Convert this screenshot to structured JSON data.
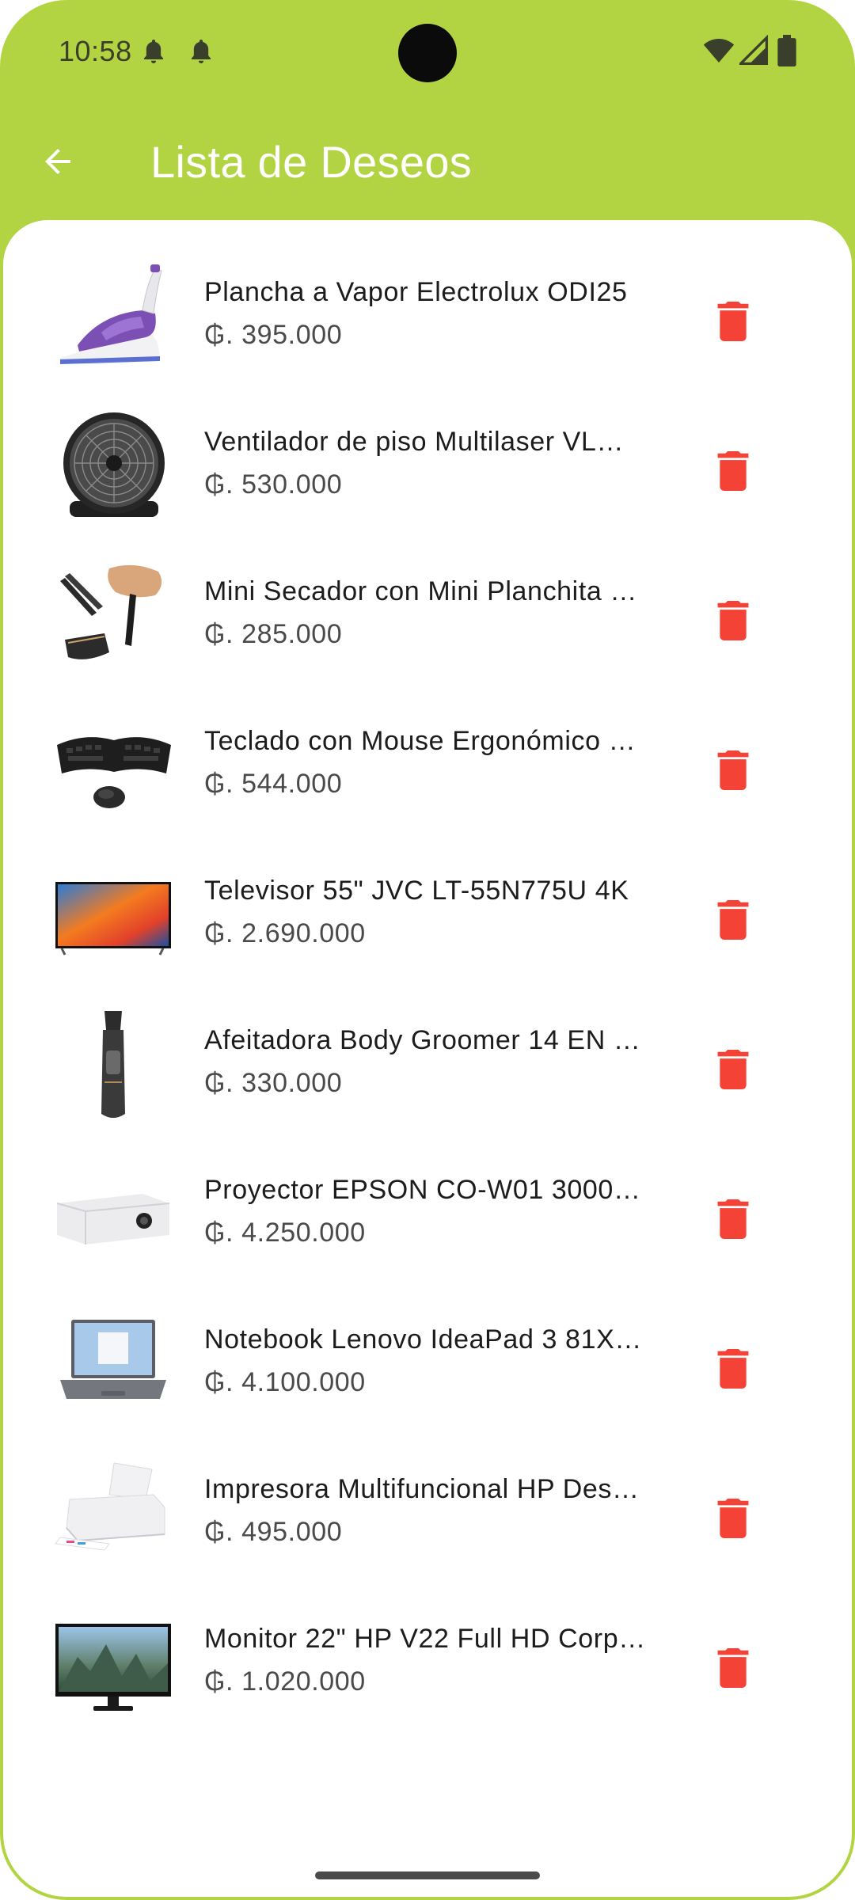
{
  "status_bar": {
    "time": "10:58",
    "icons": [
      "notification-bell-icon",
      "notification-bell-icon",
      "wifi-icon",
      "cell-signal-icon",
      "battery-icon"
    ]
  },
  "app_bar": {
    "title": "Lista de Deseos",
    "back_icon": "arrow-left-icon"
  },
  "colors": {
    "accent": "#b3d442",
    "delete": "#f44336",
    "title_text": "#ffffff"
  },
  "wishlist": {
    "items": [
      {
        "title": "Plancha a Vapor Electrolux ODI25",
        "price": "₲. 395.000",
        "image": "steam-iron-image"
      },
      {
        "title": "Ventilador de piso Multilaser VL…",
        "price": "₲. 530.000",
        "image": "floor-fan-image"
      },
      {
        "title": "Mini Secador con Mini Planchita …",
        "price": "₲. 285.000",
        "image": "hair-dryer-set-image"
      },
      {
        "title": "Teclado con Mouse Ergonómico …",
        "price": "₲. 544.000",
        "image": "keyboard-mouse-image"
      },
      {
        "title": "Televisor 55\" JVC LT-55N775U 4K",
        "price": "₲. 2.690.000",
        "image": "television-image"
      },
      {
        "title": "Afeitadora Body Groomer 14 EN …",
        "price": "₲. 330.000",
        "image": "body-groomer-image"
      },
      {
        "title": "Proyector EPSON CO-W01 3000L…",
        "price": "₲. 4.250.000",
        "image": "projector-image"
      },
      {
        "title": "Notebook Lenovo IdeaPad 3 81X…",
        "price": "₲. 4.100.000",
        "image": "laptop-image"
      },
      {
        "title": "Impresora Multifuncional HP Des…",
        "price": "₲. 495.000",
        "image": "printer-image"
      },
      {
        "title": "Monitor 22\" HP V22 Full HD Corp…",
        "price": "₲. 1.020.000",
        "image": "monitor-image"
      }
    ],
    "delete_icon": "trash-icon"
  }
}
